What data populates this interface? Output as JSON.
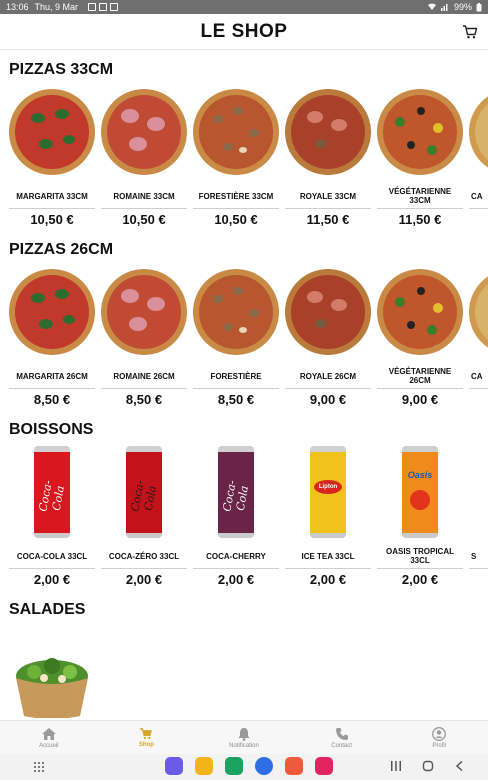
{
  "status_bar": {
    "time": "13:06",
    "date": "Thu, 9 Mar",
    "battery": "99%"
  },
  "header": {
    "title": "LE SHOP"
  },
  "sections": {
    "pizzas33": {
      "title": "PIZZAS 33CM",
      "items": [
        {
          "name": "MARGARITA 33CM",
          "price": "10,50 €"
        },
        {
          "name": "ROMAINE 33CM",
          "price": "10,50 €"
        },
        {
          "name": "FORESTIÈRE 33CM",
          "price": "10,50 €"
        },
        {
          "name": "ROYALE 33CM",
          "price": "11,50 €"
        },
        {
          "name": "VÉGÉTARIENNE 33CM",
          "price": "11,50 €"
        },
        {
          "name": "CA",
          "price": ""
        }
      ]
    },
    "pizzas26": {
      "title": "PIZZAS 26CM",
      "items": [
        {
          "name": "MARGARITA 26CM",
          "price": "8,50 €"
        },
        {
          "name": "ROMAINE 26CM",
          "price": "8,50 €"
        },
        {
          "name": "FORESTIÈRE",
          "price": "8,50 €"
        },
        {
          "name": "ROYALE 26CM",
          "price": "9,00 €"
        },
        {
          "name": "VÉGÉTARIENNE 26CM",
          "price": "9,00 €"
        },
        {
          "name": "CA",
          "price": ""
        }
      ]
    },
    "boissons": {
      "title": "BOISSONS",
      "items": [
        {
          "name": "COCA-COLA 33CL",
          "price": "2,00 €",
          "color": "#d8171e"
        },
        {
          "name": "COCA-ZÉRO 33CL",
          "price": "2,00 €",
          "color": "#c3121a"
        },
        {
          "name": "COCA-CHERRY",
          "price": "2,00 €",
          "color": "#6a2447"
        },
        {
          "name": "ICE TEA 33CL",
          "price": "2,00 €",
          "color": "#f1c21c"
        },
        {
          "name": "OASIS TROPICAL 33CL",
          "price": "2,00 €",
          "color": "#f08a1b"
        },
        {
          "name": "S",
          "price": ""
        }
      ]
    },
    "salades": {
      "title": "SALADES"
    }
  },
  "bottom_nav": {
    "items": [
      {
        "label": "Accueil",
        "icon": "home-icon"
      },
      {
        "label": "Shop",
        "icon": "cart-icon"
      },
      {
        "label": "Notification",
        "icon": "bell-icon"
      },
      {
        "label": "Contact",
        "icon": "phone-icon"
      },
      {
        "label": "Profil",
        "icon": "profile-icon"
      }
    ],
    "active": "Shop",
    "accent": "#d4a62a"
  }
}
